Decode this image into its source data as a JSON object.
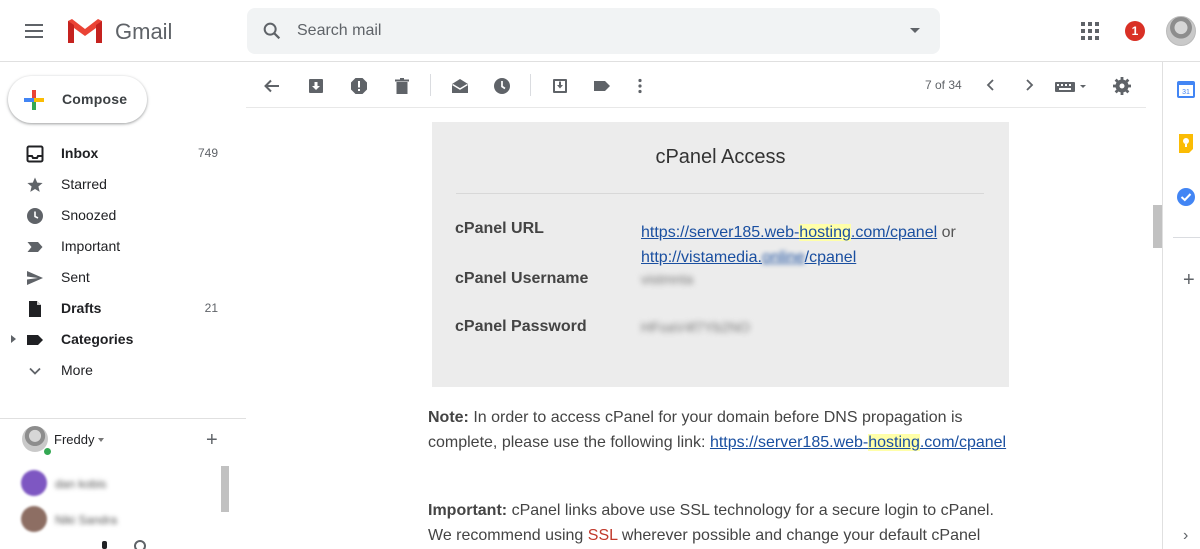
{
  "header": {
    "app_name": "Gmail",
    "search_placeholder": "Search mail",
    "notification_count": "1"
  },
  "sidebar": {
    "compose_label": "Compose",
    "items": [
      {
        "label": "Inbox",
        "count": "749",
        "bold": true,
        "icon": "inbox-icon"
      },
      {
        "label": "Starred",
        "count": "",
        "bold": false,
        "icon": "star-icon"
      },
      {
        "label": "Snoozed",
        "count": "",
        "bold": false,
        "icon": "clock-icon"
      },
      {
        "label": "Important",
        "count": "",
        "bold": false,
        "icon": "important-icon"
      },
      {
        "label": "Sent",
        "count": "",
        "bold": false,
        "icon": "send-icon"
      },
      {
        "label": "Drafts",
        "count": "21",
        "bold": true,
        "icon": "draft-icon"
      },
      {
        "label": "Categories",
        "count": "",
        "bold": true,
        "icon": "label-icon"
      },
      {
        "label": "More",
        "count": "",
        "bold": false,
        "icon": "chevron-down-icon"
      }
    ],
    "hangouts_user": "Freddy",
    "contacts": [
      {
        "name": "dan kobis",
        "color": "#7e57c2"
      },
      {
        "name": "Niki Sandra",
        "color": "#8d6e63"
      }
    ]
  },
  "toolbar": {
    "page_count": "7 of 34"
  },
  "email": {
    "box_title": "cPanel Access",
    "url_label": "cPanel URL",
    "url_link1_pre": "https://server185.web-",
    "url_link1_hl": "hosting",
    "url_link1_post": ".com/cpanel",
    "url_or": "or",
    "url_link2_pre": "http://vistamedia.",
    "url_link2_blur": "online",
    "url_link2_post": "/cpanel",
    "username_label": "cPanel Username",
    "username_value": "vistmnta",
    "password_label": "cPanel Password",
    "password_value": "HFoaV4f7Yb2NO",
    "note_strong": "Note:",
    "note_text": "In order to access cPanel for your domain before DNS propagation is complete, please use the following link:",
    "note_link_pre": "https://server185.web-",
    "note_link_hl": "hosting",
    "note_link_post": ".com/cpanel",
    "important_strong": "Important:",
    "important_text_1": "cPanel links above use SSL technology for a secure login to cPanel. We recommend using",
    "important_ssl": "SSL",
    "important_text_2": "wherever possible and change your default cPanel password"
  },
  "colors": {
    "accent_red": "#d93025",
    "link_blue": "#1a4fa0",
    "highlight": "#ffffa8",
    "panel_bg": "#ececec"
  }
}
